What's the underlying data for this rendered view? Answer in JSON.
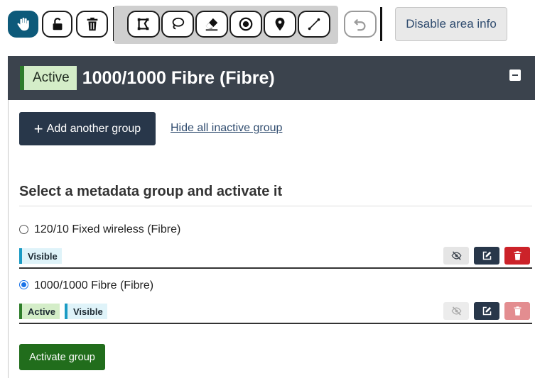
{
  "toolbar": {
    "tools": [
      {
        "name": "pan",
        "icon": "hand-icon",
        "active": true
      },
      {
        "name": "lock",
        "icon": "lock-icon"
      },
      {
        "name": "delete",
        "icon": "trash-icon"
      },
      {
        "name": "polygon",
        "icon": "polygon-icon"
      },
      {
        "name": "lasso",
        "icon": "lasso-icon"
      },
      {
        "name": "eraser",
        "icon": "eraser-icon"
      },
      {
        "name": "target",
        "icon": "target-icon"
      },
      {
        "name": "marker",
        "icon": "map-pin-icon"
      },
      {
        "name": "line",
        "icon": "line-icon"
      },
      {
        "name": "undo",
        "icon": "undo-icon",
        "disabled": true
      }
    ],
    "area_info_label": "Disable area info"
  },
  "panel": {
    "header_badge": "Active",
    "title": "1000/1000 Fibre (Fibre)",
    "collapse_icon": "minus-icon"
  },
  "actions": {
    "add_group_label": "Add another group",
    "hide_inactive_label": "Hide all inactive group"
  },
  "section": {
    "title": "Select a metadata group and activate it"
  },
  "groups": [
    {
      "label": "120/10 Fixed wireless (Fibre)",
      "selected": false,
      "badges": [
        "Visible"
      ]
    },
    {
      "label": "1000/1000 Fibre (Fibre)",
      "selected": true,
      "badges": [
        "Active",
        "Visible"
      ]
    }
  ],
  "activate_label": "Activate group",
  "colors": {
    "header_bg": "#3b434d",
    "primary_dark": "#28374a",
    "success": "#216d1c",
    "danger": "#cc2229",
    "active_tool": "#0d5a7a",
    "link": "#2f4b6e"
  }
}
